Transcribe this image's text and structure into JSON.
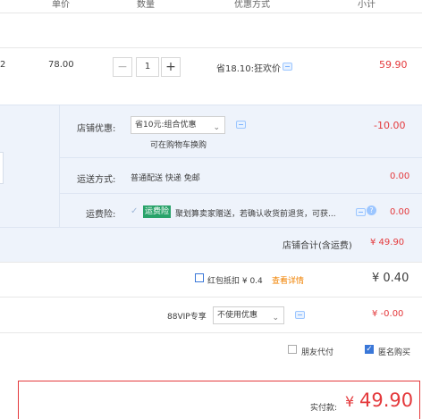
{
  "header": {
    "unit_price": "单价",
    "quantity": "数量",
    "discount_method": "优惠方式",
    "subtotal": "小计"
  },
  "item": {
    "index_fragment": "2",
    "price": "78.00",
    "minus": "−",
    "qty": "1",
    "plus": "+",
    "discount_text": "省18.10:狂欢价",
    "subtotal": "59.90"
  },
  "shop_discount": {
    "label": "店铺优惠:",
    "selected": "省10元:组合优惠",
    "note": "可在购物车换购",
    "amount": "-10.00"
  },
  "shipping": {
    "label": "运送方式:",
    "value": "普通配送 快递 免邮",
    "amount": "0.00"
  },
  "insurance": {
    "label": "运费险:",
    "badge": "运费险",
    "text": "聚划算卖家赠送，若确认收货前退货，可获...",
    "amount": "0.00"
  },
  "shop_total": {
    "label": "店铺合计(含运费)",
    "amount": "¥ 49.90"
  },
  "red_packet": {
    "label": "红包抵扣 ¥ 0.4",
    "link": "查看详情",
    "amount": "¥ 0.40"
  },
  "vip88": {
    "label": "88VIP专享",
    "selected": "不使用优惠",
    "amount": "¥ -0.00"
  },
  "options": {
    "friend_pay": "朋友代付",
    "anonymous": "匿名购买"
  },
  "pay": {
    "label": "实付款:",
    "currency": "¥",
    "amount": "49.90"
  },
  "colors": {
    "accent_red": "#e4393c",
    "panel_blue": "#eef3fb",
    "badge_green": "#29a36a"
  }
}
